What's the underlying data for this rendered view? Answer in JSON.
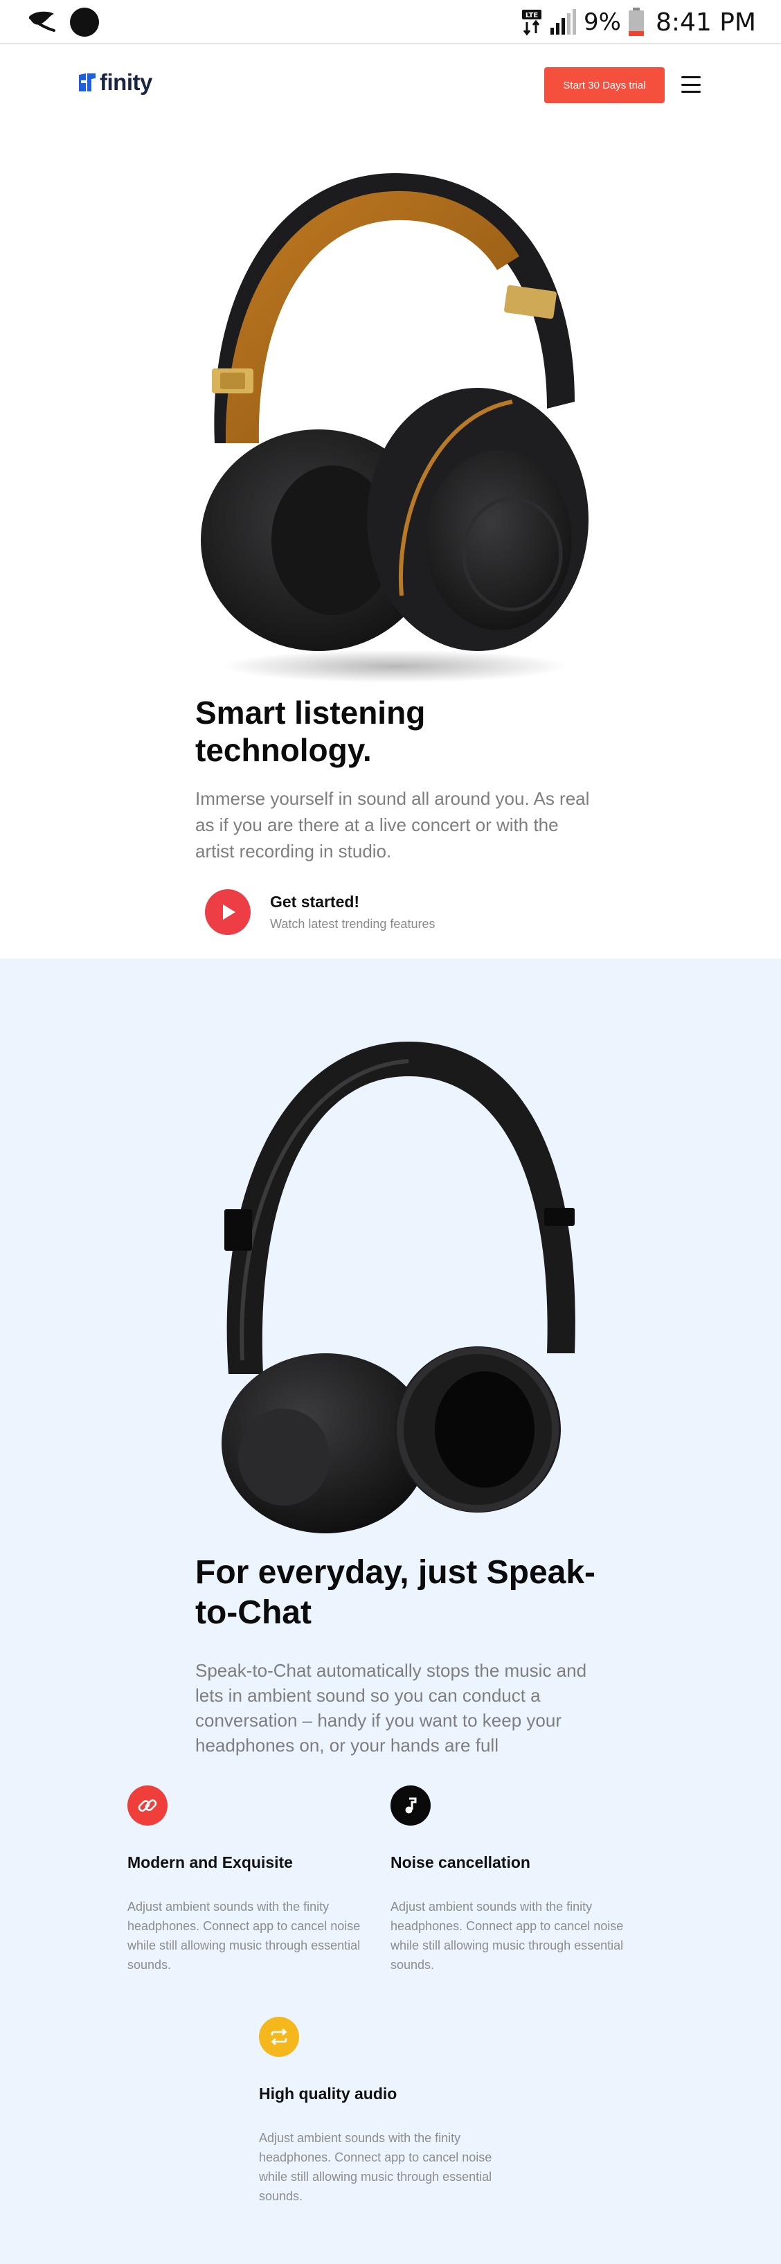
{
  "status_bar": {
    "network": "LTE",
    "battery_percent": "9%",
    "time": "8:41 PM"
  },
  "nav": {
    "logo_text": "finity",
    "trial_button": "Start 30 Days trial",
    "menu_icon": "hamburger-menu-icon"
  },
  "hero": {
    "title": "Smart listening technology.",
    "description": "Immerse yourself in sound all around you. As real as if you are there at a live concert or with the artist recording in studio.",
    "cta_title": "Get started!",
    "cta_subtitle": "Watch latest trending features",
    "cta_icon": "play-icon"
  },
  "section2": {
    "title": "For everyday, just Speak-to-Chat",
    "description": "Speak-to-Chat automatically stops the music and lets in ambient sound so you can conduct a conversation – handy if you want to keep your headphones on, or your hands are full",
    "features": [
      {
        "icon": "link-icon",
        "color": "#ef3f3b",
        "title": "Modern and Exquisite",
        "description": "Adjust ambient sounds with the finity headphones. Connect app to cancel noise while still allowing music through essential sounds."
      },
      {
        "icon": "music-note-icon",
        "color": "#0a0a0a",
        "title": "Noise cancellation",
        "description": "Adjust ambient sounds with the finity headphones. Connect app to cancel noise while still allowing music through essential sounds."
      },
      {
        "icon": "repeat-icon",
        "color": "#f5b81c",
        "title": "High quality audio",
        "description": "Adjust ambient sounds with the finity headphones. Connect app to cancel noise while still allowing music through essential sounds."
      }
    ]
  },
  "colors": {
    "accent": "#f4503d",
    "play": "#ed3e46",
    "section_bg": "#ecf4fd",
    "brand_blue": "#1e5fe0"
  }
}
